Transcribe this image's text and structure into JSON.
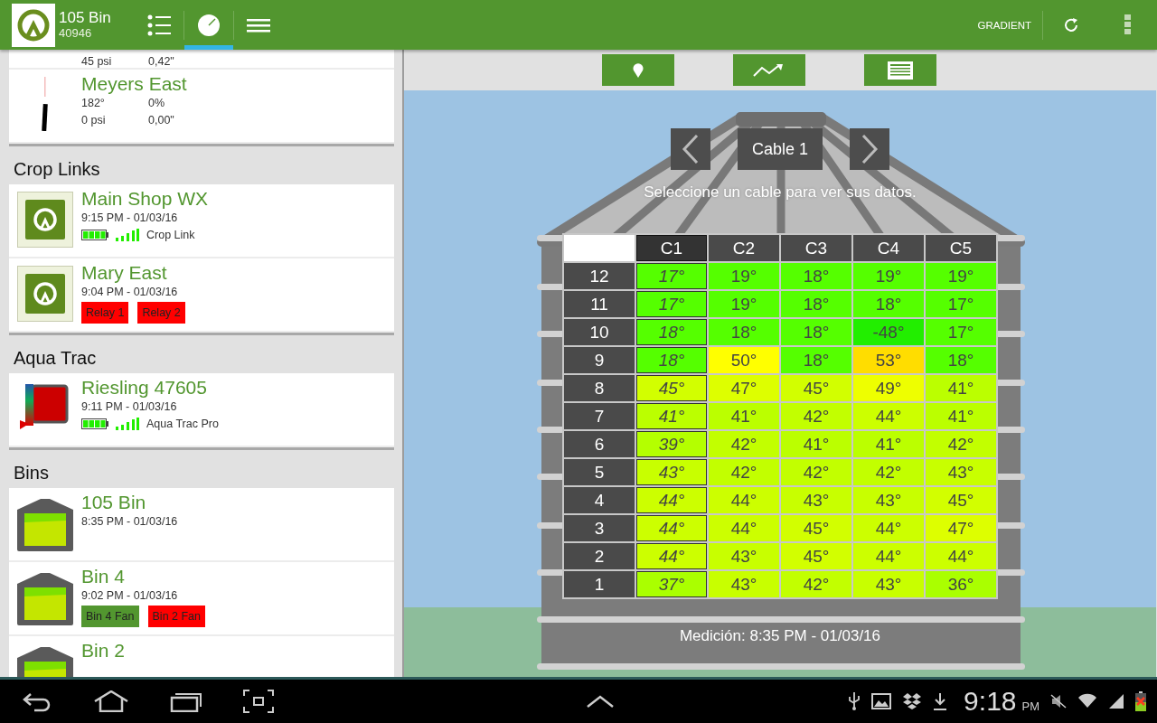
{
  "app_bar": {
    "title": "105 Bin",
    "subtitle": "40946",
    "tabs": [
      {
        "kind": "list",
        "selected": false
      },
      {
        "kind": "gauge",
        "selected": true
      },
      {
        "kind": "menu",
        "selected": false
      }
    ],
    "action": "GRADIENT"
  },
  "sidebar": {
    "pivot_cards": [
      {
        "rows": [
          [
            "45 psi",
            "0,42\""
          ]
        ]
      },
      {
        "name": "Meyers East",
        "rows": [
          [
            "182°",
            "0%"
          ],
          [
            "0 psi",
            "0,00\""
          ]
        ]
      }
    ],
    "sections": [
      {
        "title": "Crop Links",
        "items": [
          {
            "kind": "croplink",
            "name": "Main Shop WX",
            "time": "9:15 PM - 01/03/16",
            "device": "Crop Link"
          },
          {
            "kind": "croplink",
            "name": "Mary East",
            "time": "9:04 PM - 01/03/16",
            "tags": [
              {
                "label": "Relay 1",
                "color": "#ff0000"
              },
              {
                "label": "Relay 2",
                "color": "#ff0000"
              }
            ]
          }
        ]
      },
      {
        "title": "Aqua Trac",
        "items": [
          {
            "kind": "aquatrac",
            "name": "Riesling 47605",
            "time": "9:11 PM - 01/03/16",
            "device": "Aqua Trac Pro"
          }
        ]
      },
      {
        "title": "Bins",
        "items": [
          {
            "kind": "bin",
            "name": "105 Bin",
            "time": "8:35 PM - 01/03/16"
          },
          {
            "kind": "bin",
            "name": "Bin 4",
            "time": "9:02 PM - 01/03/16",
            "tags": [
              {
                "label": "Bin 4 Fan",
                "color": "#52962f"
              },
              {
                "label": "Bin 2 Fan",
                "color": "#ff0000"
              }
            ]
          },
          {
            "kind": "bin",
            "name": "Bin 2"
          }
        ]
      }
    ]
  },
  "toolbar": [
    {
      "kind": "pin"
    },
    {
      "kind": "trend"
    },
    {
      "kind": "table"
    }
  ],
  "cable": {
    "label": "Cable 1",
    "hint": "Seleccione un cable para ver sus datos.",
    "measured": "Medición: 8:35 PM - 01/03/16"
  },
  "table": {
    "columns": [
      {
        "label": "C1",
        "selected": true
      },
      {
        "label": "C2",
        "selected": false
      },
      {
        "label": "C3",
        "selected": false
      },
      {
        "label": "C4",
        "selected": false
      },
      {
        "label": "C5",
        "selected": false
      }
    ],
    "rows": [
      {
        "label": "12",
        "cells": [
          {
            "value": "17°",
            "color": "#55ff00"
          },
          {
            "value": "19°",
            "color": "#55ff00"
          },
          {
            "value": "18°",
            "color": "#55ff00"
          },
          {
            "value": "19°",
            "color": "#55ff00"
          },
          {
            "value": "19°",
            "color": "#55ff00"
          }
        ]
      },
      {
        "label": "11",
        "cells": [
          {
            "value": "17°",
            "color": "#55ff00"
          },
          {
            "value": "19°",
            "color": "#55ff00"
          },
          {
            "value": "18°",
            "color": "#55ff00"
          },
          {
            "value": "18°",
            "color": "#55ff00"
          },
          {
            "value": "17°",
            "color": "#55ff00"
          }
        ]
      },
      {
        "label": "10",
        "cells": [
          {
            "value": "18°",
            "color": "#55ff00"
          },
          {
            "value": "18°",
            "color": "#55ff00"
          },
          {
            "value": "18°",
            "color": "#55ff00"
          },
          {
            "value": "-48°",
            "color": "#22ee00"
          },
          {
            "value": "17°",
            "color": "#55ff00"
          }
        ]
      },
      {
        "label": "9",
        "cells": [
          {
            "value": "18°",
            "color": "#55ff00"
          },
          {
            "value": "50°",
            "color": "#ffff00"
          },
          {
            "value": "18°",
            "color": "#55ff00"
          },
          {
            "value": "53°",
            "color": "#ffdd00"
          },
          {
            "value": "18°",
            "color": "#55ff00"
          }
        ]
      },
      {
        "label": "8",
        "cells": [
          {
            "value": "45°",
            "color": "#d2ff00"
          },
          {
            "value": "47°",
            "color": "#ddff00"
          },
          {
            "value": "45°",
            "color": "#d2ff00"
          },
          {
            "value": "49°",
            "color": "#eeff00"
          },
          {
            "value": "41°",
            "color": "#bbff00"
          }
        ]
      },
      {
        "label": "7",
        "cells": [
          {
            "value": "41°",
            "color": "#bbff00"
          },
          {
            "value": "41°",
            "color": "#bbff00"
          },
          {
            "value": "42°",
            "color": "#c2ff00"
          },
          {
            "value": "44°",
            "color": "#ccff00"
          },
          {
            "value": "41°",
            "color": "#bbff00"
          }
        ]
      },
      {
        "label": "6",
        "cells": [
          {
            "value": "39°",
            "color": "#b4ff00"
          },
          {
            "value": "42°",
            "color": "#c2ff00"
          },
          {
            "value": "41°",
            "color": "#bbff00"
          },
          {
            "value": "41°",
            "color": "#bbff00"
          },
          {
            "value": "42°",
            "color": "#c2ff00"
          }
        ]
      },
      {
        "label": "5",
        "cells": [
          {
            "value": "43°",
            "color": "#c8ff00"
          },
          {
            "value": "42°",
            "color": "#c2ff00"
          },
          {
            "value": "42°",
            "color": "#c2ff00"
          },
          {
            "value": "42°",
            "color": "#c2ff00"
          },
          {
            "value": "43°",
            "color": "#c8ff00"
          }
        ]
      },
      {
        "label": "4",
        "cells": [
          {
            "value": "44°",
            "color": "#ccff00"
          },
          {
            "value": "44°",
            "color": "#ccff00"
          },
          {
            "value": "43°",
            "color": "#c8ff00"
          },
          {
            "value": "43°",
            "color": "#c8ff00"
          },
          {
            "value": "45°",
            "color": "#d2ff00"
          }
        ]
      },
      {
        "label": "3",
        "cells": [
          {
            "value": "44°",
            "color": "#ccff00"
          },
          {
            "value": "44°",
            "color": "#ccff00"
          },
          {
            "value": "45°",
            "color": "#d2ff00"
          },
          {
            "value": "44°",
            "color": "#ccff00"
          },
          {
            "value": "47°",
            "color": "#ddff00"
          }
        ]
      },
      {
        "label": "2",
        "cells": [
          {
            "value": "44°",
            "color": "#ccff00"
          },
          {
            "value": "43°",
            "color": "#c8ff00"
          },
          {
            "value": "45°",
            "color": "#d2ff00"
          },
          {
            "value": "44°",
            "color": "#ccff00"
          },
          {
            "value": "44°",
            "color": "#ccff00"
          }
        ]
      },
      {
        "label": "1",
        "cells": [
          {
            "value": "37°",
            "color": "#aaff00"
          },
          {
            "value": "43°",
            "color": "#c8ff00"
          },
          {
            "value": "42°",
            "color": "#c2ff00"
          },
          {
            "value": "43°",
            "color": "#c8ff00"
          },
          {
            "value": "36°",
            "color": "#aaff00"
          }
        ]
      }
    ]
  },
  "system_bar": {
    "time": "9:18",
    "ampm": "PM"
  }
}
